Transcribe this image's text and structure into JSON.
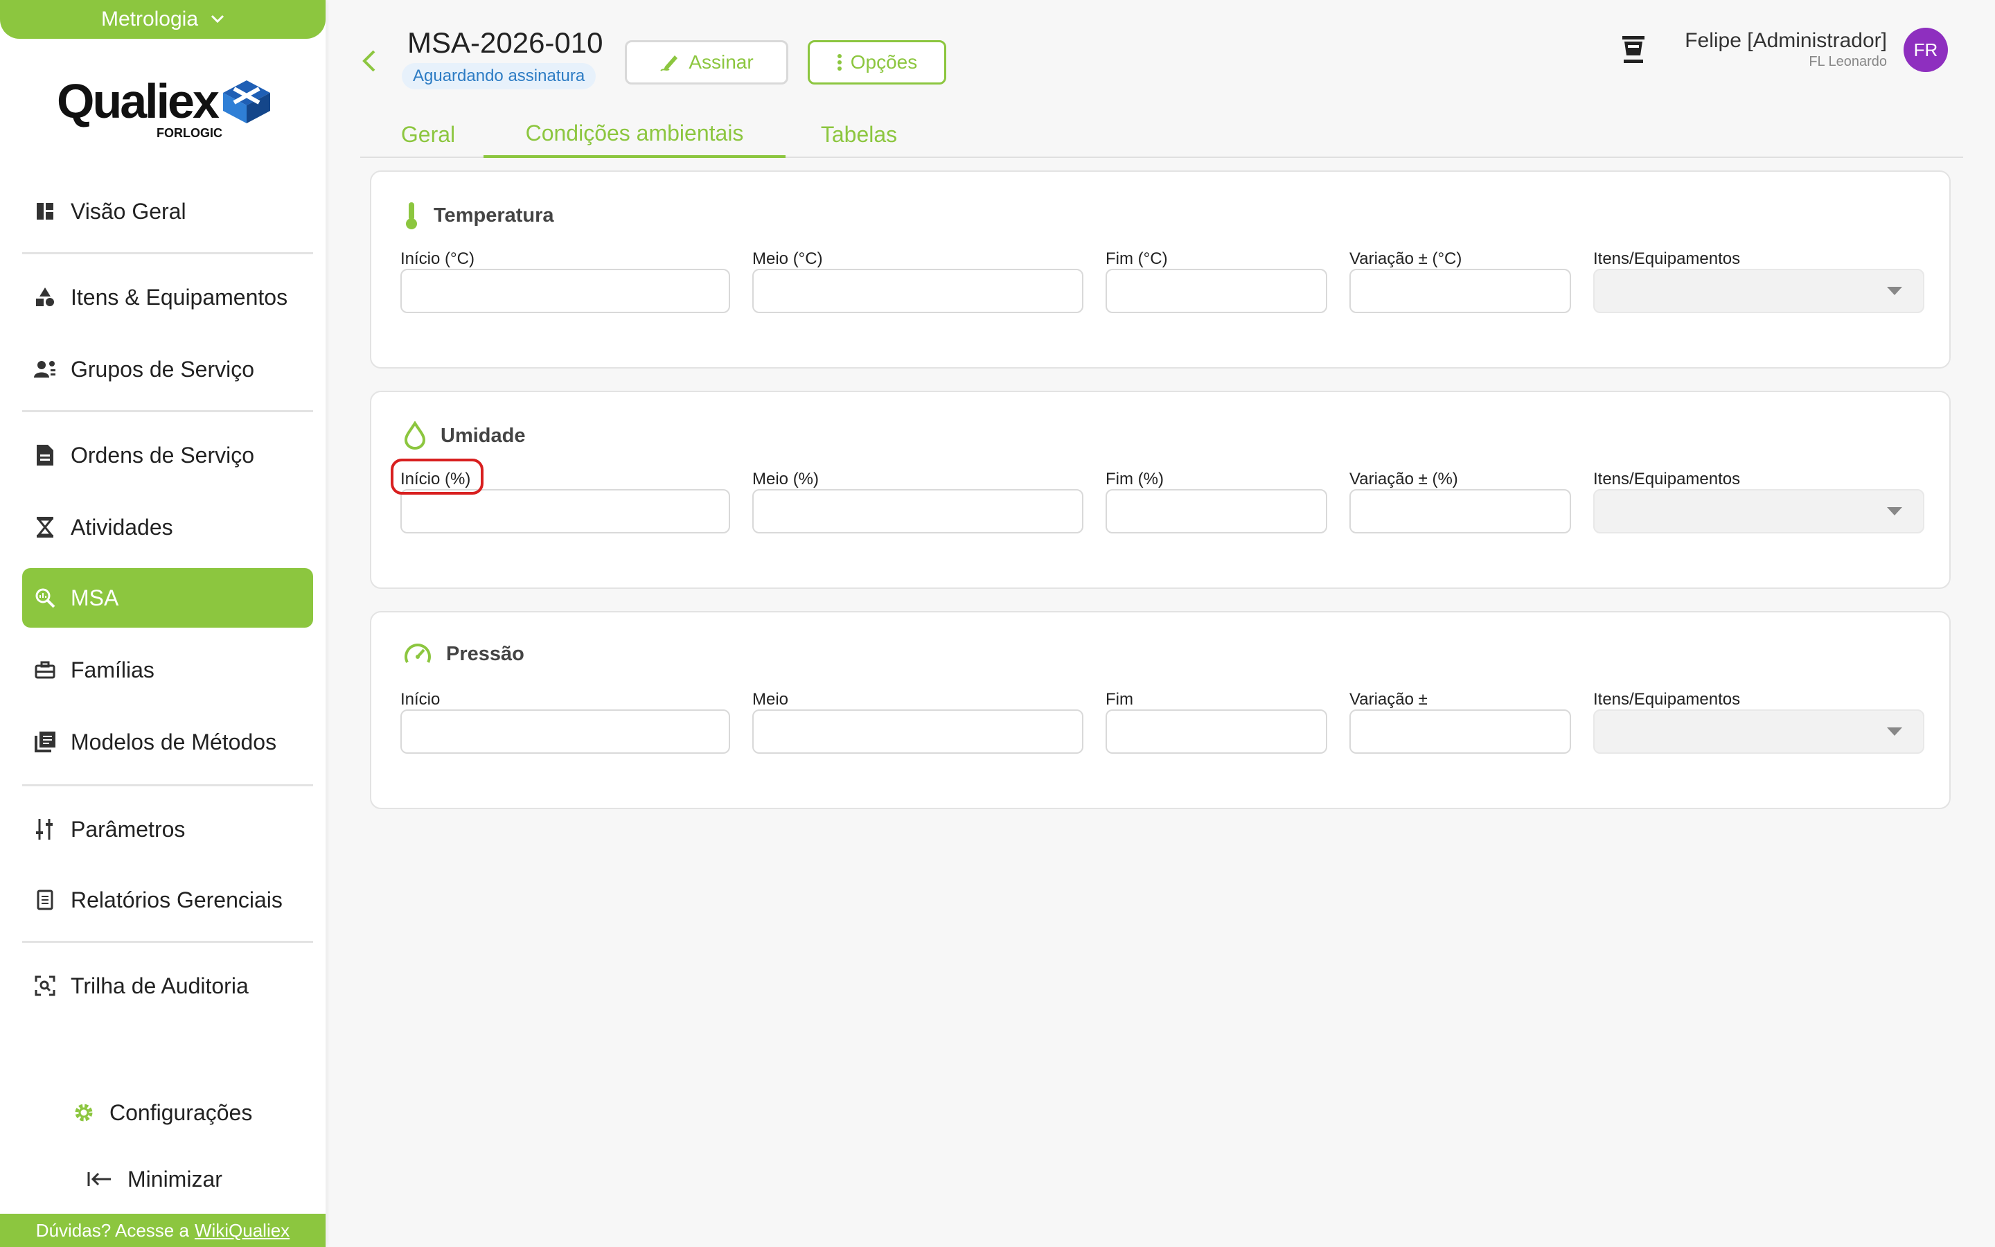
{
  "sidebar": {
    "module": "Metrologia",
    "logo": {
      "name": "Qualiex",
      "sub": "FORLOGIC"
    },
    "items": [
      {
        "label": "Visão Geral",
        "icon": "dashboard-icon"
      },
      {
        "label": "Itens & Equipamentos",
        "icon": "shapes-icon"
      },
      {
        "label": "Grupos de Serviço",
        "icon": "group-icon"
      },
      {
        "label": "Ordens de Serviço",
        "icon": "document-icon"
      },
      {
        "label": "Atividades",
        "icon": "hourglass-icon"
      },
      {
        "label": "MSA",
        "icon": "magnifier-icon",
        "active": true
      },
      {
        "label": "Famílias",
        "icon": "toolbox-icon"
      },
      {
        "label": "Modelos de Métodos",
        "icon": "library-icon"
      },
      {
        "label": "Parâmetros",
        "icon": "sliders-icon"
      },
      {
        "label": "Relatórios Gerenciais",
        "icon": "report-icon"
      },
      {
        "label": "Trilha de Auditoria",
        "icon": "audit-icon"
      }
    ],
    "settings_label": "Configurações",
    "minimize_label": "Minimizar",
    "help_prefix": "Dúvidas? Acesse a",
    "help_link": "WikiQualiex"
  },
  "header": {
    "title": "MSA-2026-010",
    "status": "Aguardando assinatura",
    "sign_label": "Assinar",
    "options_label": "Opções",
    "user_name": "Felipe [Administrador]",
    "user_org": "FL Leonardo",
    "avatar_initials": "FR"
  },
  "tabs": [
    {
      "label": "Geral",
      "active": false
    },
    {
      "label": "Condições ambientais",
      "active": true
    },
    {
      "label": "Tabelas",
      "active": false
    }
  ],
  "sections": [
    {
      "title": "Temperatura",
      "icon": "thermometer-icon",
      "fields": [
        {
          "label": "Início (°C)",
          "value": ""
        },
        {
          "label": "Meio (°C)",
          "value": ""
        },
        {
          "label": "Fim (°C)",
          "value": ""
        },
        {
          "label": "Variação ± (°C)",
          "value": ""
        }
      ],
      "equipment_label": "Itens/Equipamentos",
      "equipment_value": ""
    },
    {
      "title": "Umidade",
      "icon": "droplet-icon",
      "fields": [
        {
          "label": "Início (%)",
          "value": ""
        },
        {
          "label": "Meio (%)",
          "value": ""
        },
        {
          "label": "Fim (%)",
          "value": ""
        },
        {
          "label": "Variação ± (%)",
          "value": ""
        }
      ],
      "equipment_label": "Itens/Equipamentos",
      "equipment_value": ""
    },
    {
      "title": "Pressão",
      "icon": "gauge-icon",
      "fields": [
        {
          "label": "Início",
          "value": ""
        },
        {
          "label": "Meio",
          "value": ""
        },
        {
          "label": "Fim",
          "value": ""
        },
        {
          "label": "Variação ±",
          "value": ""
        }
      ],
      "equipment_label": "Itens/Equipamentos",
      "equipment_value": ""
    }
  ],
  "colors": {
    "accent": "#8cc63f",
    "status_text": "#2d7cc4",
    "status_bg": "#e7f1fb",
    "avatar": "#8e2fbf",
    "highlight": "#d81f1f"
  }
}
